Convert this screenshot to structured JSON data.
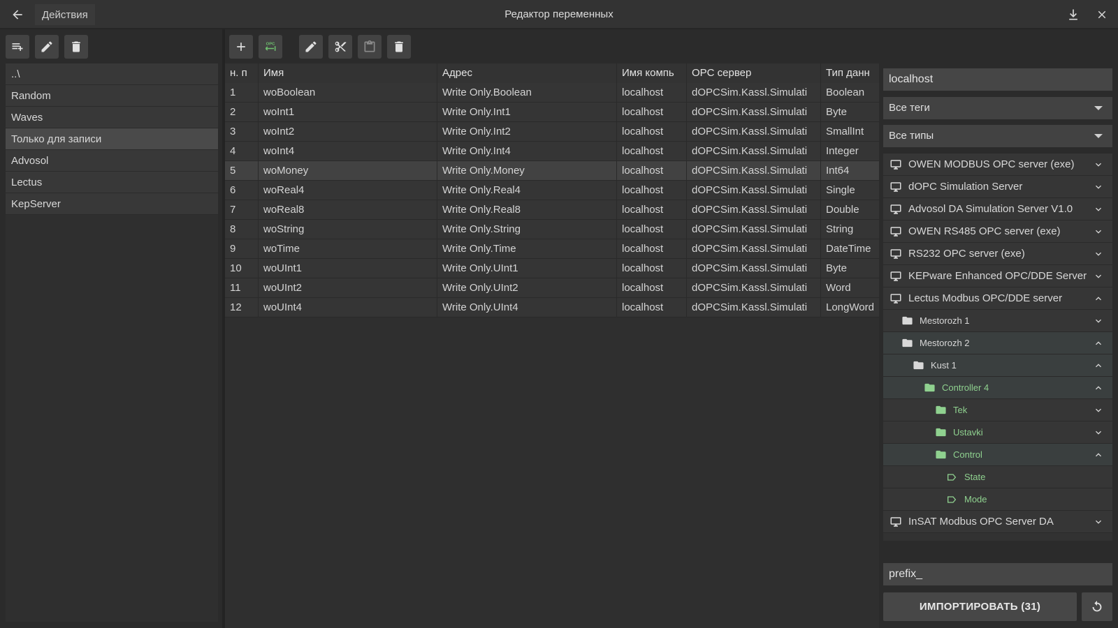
{
  "titlebar": {
    "back_icon": "arrow-left-icon",
    "actions_label": "Действия",
    "title": "Редактор переменных"
  },
  "folders": [
    {
      "label": "..\\"
    },
    {
      "label": "Random"
    },
    {
      "label": "Waves"
    },
    {
      "label": "Только для записи",
      "selected": true
    },
    {
      "label": "Advosol"
    },
    {
      "label": "Lectus"
    },
    {
      "label": "KepServer"
    }
  ],
  "mid_toolbar": {
    "opc_label": "OPC"
  },
  "grid": {
    "headers": [
      "н. п",
      "Имя",
      "Адрес",
      "Имя компь",
      "OPC сервер",
      "Тип данн"
    ],
    "rows": [
      [
        "1",
        "woBoolean",
        "Write Only.Boolean",
        "localhost",
        "dOPCSim.Kassl.Simulati",
        "Boolean"
      ],
      [
        "2",
        "woInt1",
        "Write Only.Int1",
        "localhost",
        "dOPCSim.Kassl.Simulati",
        "Byte"
      ],
      [
        "3",
        "woInt2",
        "Write Only.Int2",
        "localhost",
        "dOPCSim.Kassl.Simulati",
        "SmallInt"
      ],
      [
        "4",
        "woInt4",
        "Write Only.Int4",
        "localhost",
        "dOPCSim.Kassl.Simulati",
        "Integer"
      ],
      [
        "5",
        "woMoney",
        "Write Only.Money",
        "localhost",
        "dOPCSim.Kassl.Simulati",
        "Int64"
      ],
      [
        "6",
        "woReal4",
        "Write Only.Real4",
        "localhost",
        "dOPCSim.Kassl.Simulati",
        "Single"
      ],
      [
        "7",
        "woReal8",
        "Write Only.Real8",
        "localhost",
        "dOPCSim.Kassl.Simulati",
        "Double"
      ],
      [
        "8",
        "woString",
        "Write Only.String",
        "localhost",
        "dOPCSim.Kassl.Simulati",
        "String"
      ],
      [
        "9",
        "woTime",
        "Write Only.Time",
        "localhost",
        "dOPCSim.Kassl.Simulati",
        "DateTime"
      ],
      [
        "10",
        "woUInt1",
        "Write Only.UInt1",
        "localhost",
        "dOPCSim.Kassl.Simulati",
        "Byte"
      ],
      [
        "11",
        "woUInt2",
        "Write Only.UInt2",
        "localhost",
        "dOPCSim.Kassl.Simulati",
        "Word"
      ],
      [
        "12",
        "woUInt4",
        "Write Only.UInt4",
        "localhost",
        "dOPCSim.Kassl.Simulati",
        "LongWord"
      ]
    ],
    "selected_row": 4
  },
  "right": {
    "host_value": "localhost",
    "tags_filter": "Все теги",
    "types_filter": "Все типы",
    "tree": [
      {
        "label": "OWEN MODBUS OPC server (exe)",
        "kind": "server",
        "level": 0,
        "open": false
      },
      {
        "label": "dOPC Simulation Server",
        "kind": "server",
        "level": 0,
        "open": false
      },
      {
        "label": "Advosol DA Simulation Server V1.0",
        "kind": "server",
        "level": 0,
        "open": false
      },
      {
        "label": "OWEN RS485 OPC server (exe)",
        "kind": "server",
        "level": 0,
        "open": false
      },
      {
        "label": "RS232 OPC server (exe)",
        "kind": "server",
        "level": 0,
        "open": false
      },
      {
        "label": "KEPware Enhanced OPC/DDE Server",
        "kind": "server",
        "level": 0,
        "open": false
      },
      {
        "label": "Lectus Modbus OPC/DDE server",
        "kind": "server",
        "level": 0,
        "open": true
      },
      {
        "label": "Mestorozh 1",
        "kind": "folder",
        "level": 1,
        "open": false
      },
      {
        "label": "Mestorozh 2",
        "kind": "folder",
        "level": 1,
        "open": true
      },
      {
        "label": "Kust 1",
        "kind": "folder",
        "level": 2,
        "open": true
      },
      {
        "label": "Controller 4",
        "kind": "folder-green",
        "level": 3,
        "open": true
      },
      {
        "label": "Tek",
        "kind": "folder-green",
        "level": 4,
        "open": false
      },
      {
        "label": "Ustavki",
        "kind": "folder-green",
        "level": 4,
        "open": false
      },
      {
        "label": "Control",
        "kind": "folder-green",
        "level": 4,
        "open": true
      },
      {
        "label": "State",
        "kind": "tag",
        "level": 5
      },
      {
        "label": "Mode",
        "kind": "tag",
        "level": 5
      },
      {
        "label": "InSAT Modbus OPC Server DA",
        "kind": "server",
        "level": 0,
        "open": false
      }
    ],
    "prefix_value": "prefix_",
    "import_label": "ИМПОРТИРОВАТЬ (31)"
  }
}
